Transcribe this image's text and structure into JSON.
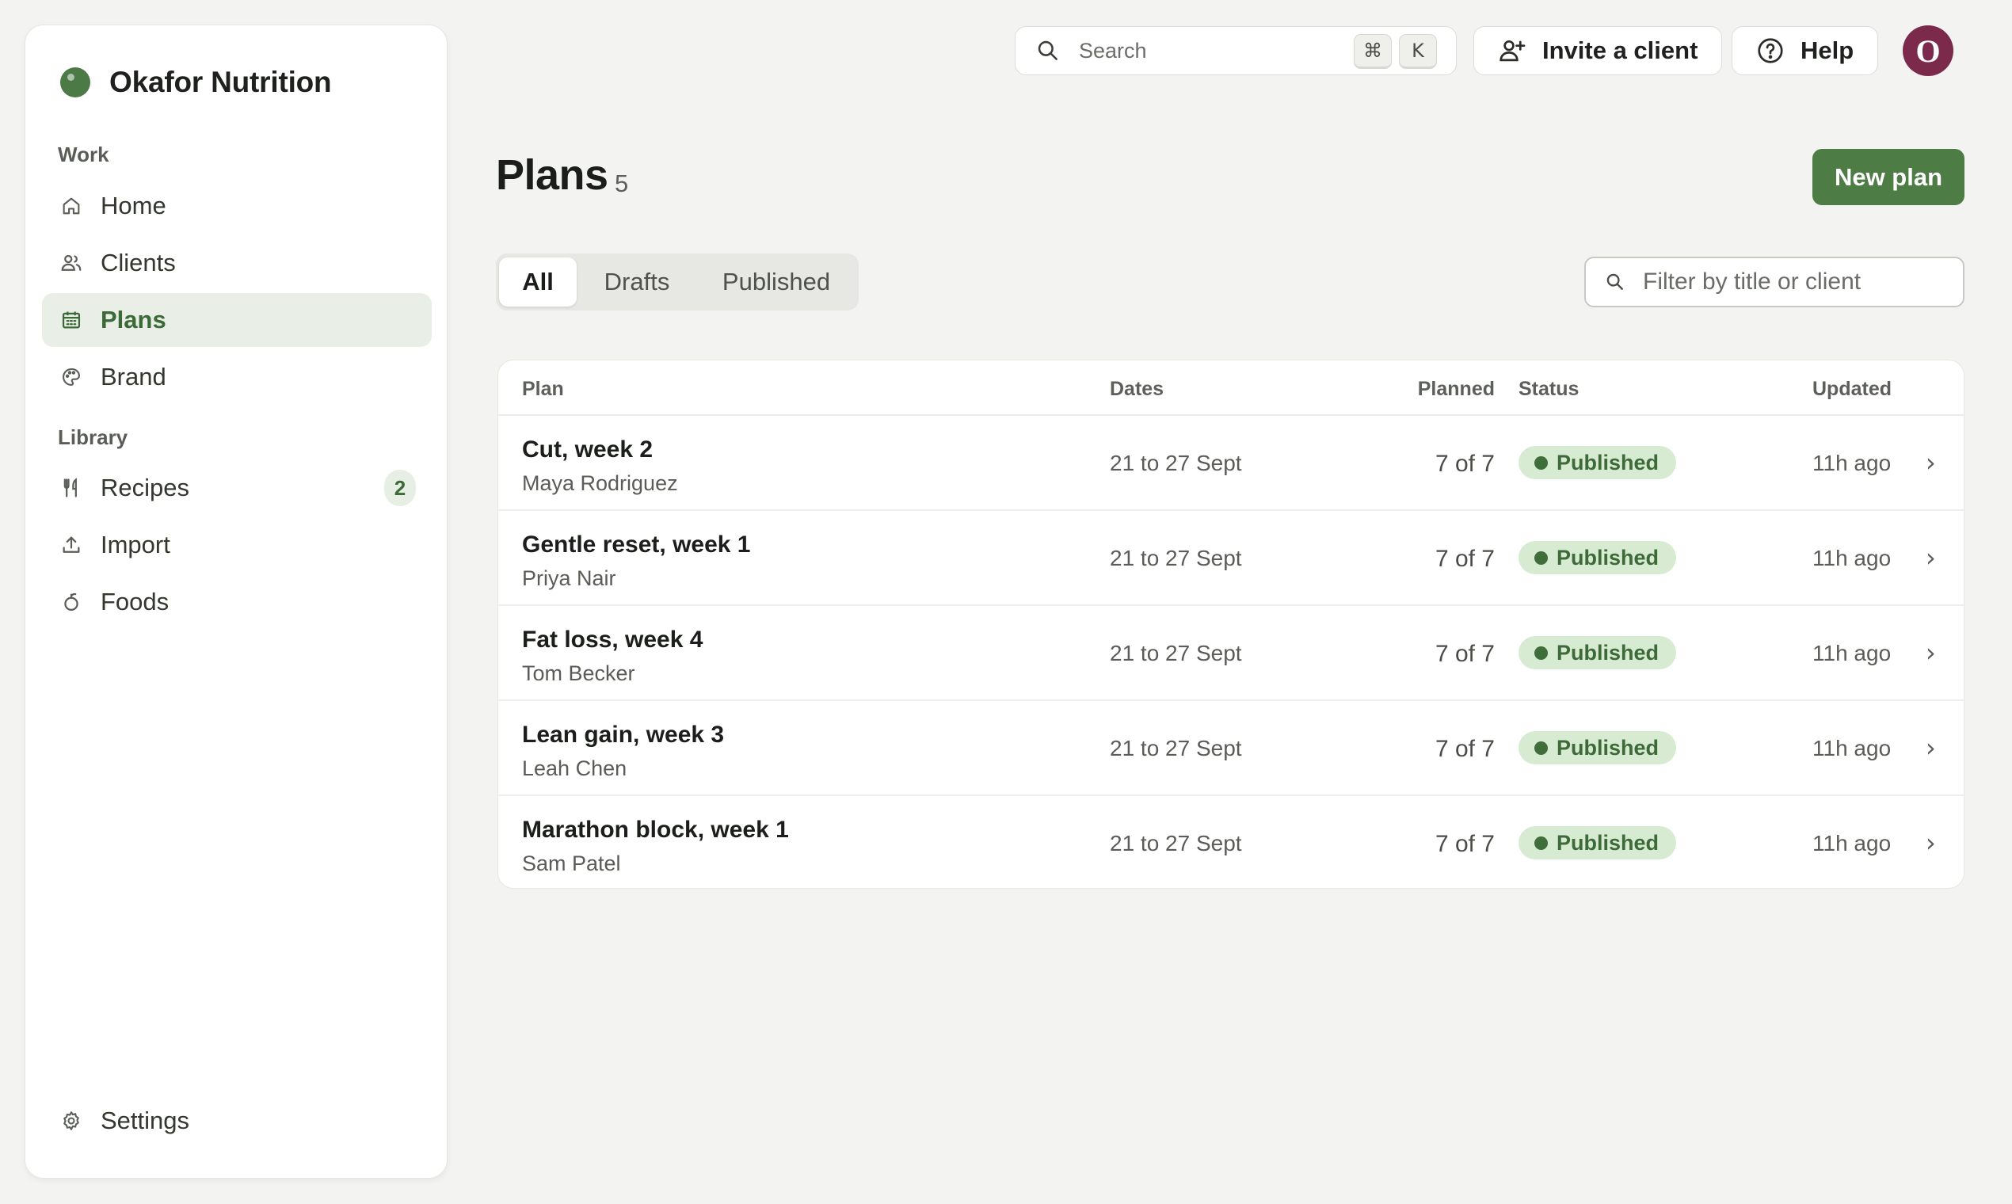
{
  "brand": {
    "name": "Okafor Nutrition",
    "color": "#4b7a47"
  },
  "sidebar": {
    "sections": [
      {
        "label": "Work"
      },
      {
        "label": "Library"
      }
    ],
    "items": [
      {
        "label": "Home",
        "icon": "home-icon"
      },
      {
        "label": "Clients",
        "icon": "users-icon"
      },
      {
        "label": "Plans",
        "icon": "calendar-icon",
        "active": true
      },
      {
        "label": "Brand",
        "icon": "palette-icon"
      },
      {
        "label": "Recipes",
        "icon": "utensils-icon",
        "badge": "2"
      },
      {
        "label": "Import",
        "icon": "upload-icon"
      },
      {
        "label": "Foods",
        "icon": "apple-icon"
      }
    ],
    "settings": {
      "label": "Settings",
      "icon": "gear-icon"
    }
  },
  "topbar": {
    "search_placeholder": "Search",
    "shortcut": [
      "⌘",
      "K"
    ],
    "invite_label": "Invite a client",
    "help_label": "Help",
    "avatar_initial": "O",
    "avatar_color": "#7b2a4b"
  },
  "header": {
    "title": "Plans",
    "count": "5",
    "new_button": "New plan",
    "accent": "#4d7c45"
  },
  "tabs": [
    {
      "label": "All",
      "active": true
    },
    {
      "label": "Drafts"
    },
    {
      "label": "Published"
    }
  ],
  "filter": {
    "placeholder": "Filter by title or client"
  },
  "table": {
    "columns": {
      "plan": "Plan",
      "dates": "Dates",
      "planned": "Planned",
      "status": "Status",
      "updated": "Updated"
    },
    "rows": [
      {
        "title": "Cut, week 2",
        "client": "Maya Rodriguez",
        "dates": "21 to 27 Sept",
        "planned": "7 of 7",
        "status": "Published",
        "updated": "11h ago"
      },
      {
        "title": "Gentle reset, week 1",
        "client": "Priya Nair",
        "dates": "21 to 27 Sept",
        "planned": "7 of 7",
        "status": "Published",
        "updated": "11h ago"
      },
      {
        "title": "Fat loss, week 4",
        "client": "Tom Becker",
        "dates": "21 to 27 Sept",
        "planned": "7 of 7",
        "status": "Published",
        "updated": "11h ago"
      },
      {
        "title": "Lean gain, week 3",
        "client": "Leah Chen",
        "dates": "21 to 27 Sept",
        "planned": "7 of 7",
        "status": "Published",
        "updated": "11h ago"
      },
      {
        "title": "Marathon block, week 1",
        "client": "Sam Patel",
        "dates": "21 to 27 Sept",
        "planned": "7 of 7",
        "status": "Published",
        "updated": "11h ago"
      }
    ],
    "status_color": "#3e6a3a"
  }
}
